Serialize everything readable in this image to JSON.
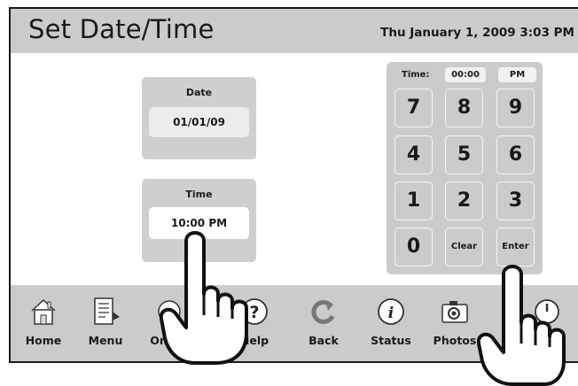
{
  "header": {
    "title": "Set Date/Time",
    "datetime": "Thu January 1, 2009  3:03 PM"
  },
  "date_panel": {
    "label": "Date",
    "value": "01/01/09"
  },
  "time_panel": {
    "label": "Time",
    "value": "10:00 PM"
  },
  "keypad": {
    "time_label": "Time:",
    "time_value": "00:00",
    "ampm": "PM",
    "keys": [
      "7",
      "8",
      "9",
      "4",
      "5",
      "6",
      "1",
      "2",
      "3",
      "0",
      "Clear",
      "Enter"
    ]
  },
  "toolbar": {
    "items": [
      {
        "label": "Home",
        "icon": "home-icon"
      },
      {
        "label": "Menu",
        "icon": "menu-icon"
      },
      {
        "label": "OneTo",
        "icon": "onetouch-icon"
      },
      {
        "label": "Help",
        "icon": "help-icon"
      },
      {
        "label": "Back",
        "icon": "back-icon"
      },
      {
        "label": "Status",
        "icon": "status-icon"
      },
      {
        "label": "Photos",
        "icon": "camera-icon"
      },
      {
        "label": "",
        "icon": "power-icon"
      }
    ]
  },
  "colors": {
    "panel": "#cbcbcb",
    "frame": "#1a1a1a",
    "field": "#ffffff"
  }
}
